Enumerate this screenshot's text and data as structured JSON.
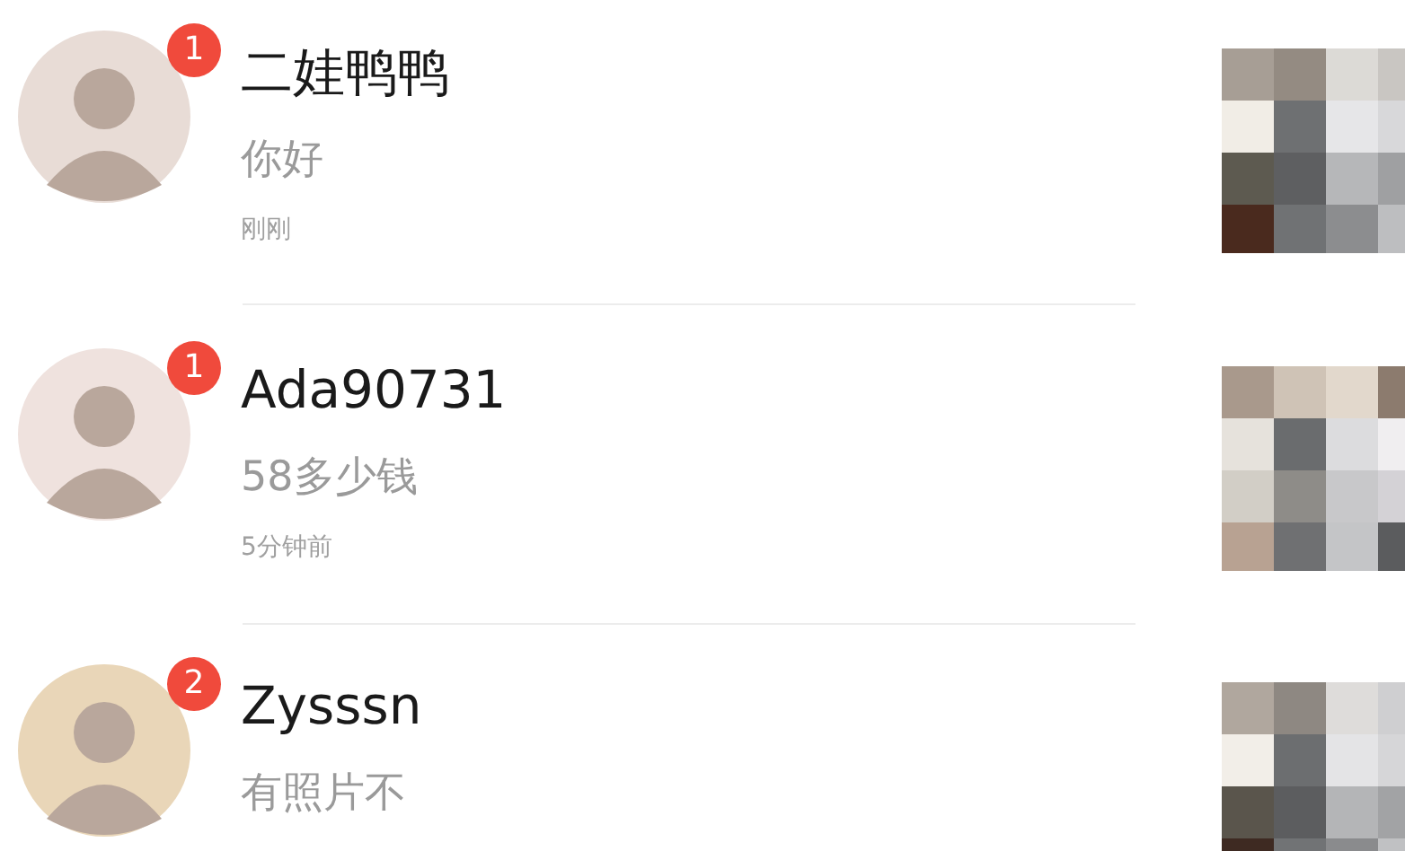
{
  "conversations": [
    {
      "name": "二娃鸭鸭",
      "message": "你好",
      "time": "刚刚",
      "unread": "1"
    },
    {
      "name": "Ada90731",
      "message": "58多少钱",
      "time": "5分钟前",
      "unread": "1"
    },
    {
      "name": "Zysssn",
      "message": "有照片不",
      "unread": "2"
    }
  ]
}
